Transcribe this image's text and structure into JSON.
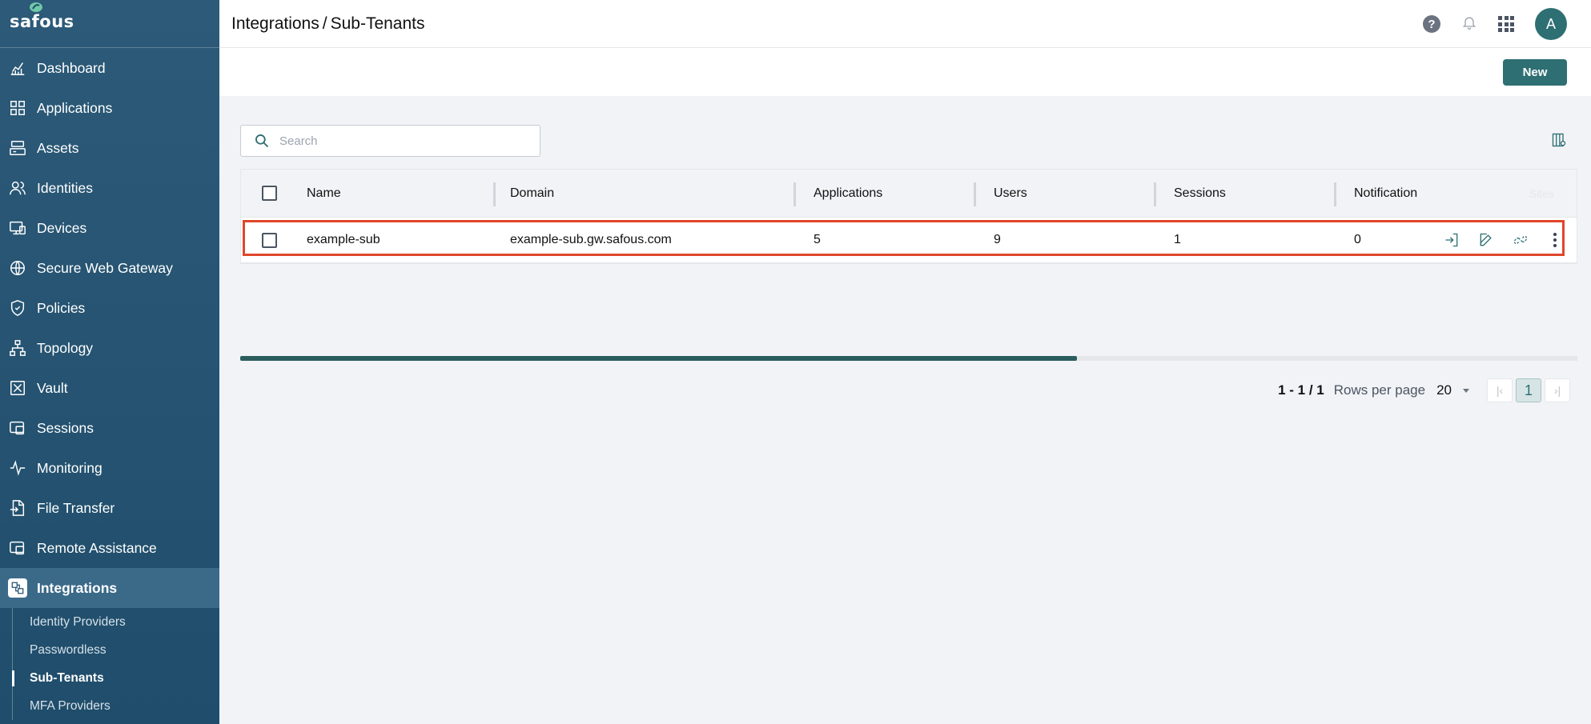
{
  "app": {
    "logo_text": "safous"
  },
  "sidebar": {
    "items": [
      {
        "label": "Dashboard",
        "icon": "chart-line-icon"
      },
      {
        "label": "Applications",
        "icon": "grid-icon"
      },
      {
        "label": "Assets",
        "icon": "server-icon"
      },
      {
        "label": "Identities",
        "icon": "users-icon"
      },
      {
        "label": "Devices",
        "icon": "devices-icon"
      },
      {
        "label": "Secure Web Gateway",
        "icon": "globe-icon"
      },
      {
        "label": "Policies",
        "icon": "shield-icon"
      },
      {
        "label": "Topology",
        "icon": "topology-icon"
      },
      {
        "label": "Vault",
        "icon": "vault-icon"
      },
      {
        "label": "Sessions",
        "icon": "sessions-icon"
      },
      {
        "label": "Monitoring",
        "icon": "pulse-icon"
      },
      {
        "label": "File Transfer",
        "icon": "file-transfer-icon"
      },
      {
        "label": "Remote Assistance",
        "icon": "remote-icon"
      },
      {
        "label": "Integrations",
        "icon": "integrations-icon",
        "active": true
      }
    ],
    "subitems": [
      {
        "label": "Identity Providers"
      },
      {
        "label": "Passwordless"
      },
      {
        "label": "Sub-Tenants",
        "active": true
      },
      {
        "label": "MFA Providers"
      }
    ]
  },
  "header": {
    "breadcrumb_parent": "Integrations",
    "breadcrumb_sep": "/",
    "breadcrumb_current": "Sub-Tenants",
    "avatar_initial": "A"
  },
  "toolbar": {
    "new_label": "New"
  },
  "search": {
    "placeholder": "Search",
    "value": ""
  },
  "table": {
    "columns": [
      "Name",
      "Domain",
      "Applications",
      "Users",
      "Sessions",
      "Notification",
      "Sites"
    ],
    "rows": [
      {
        "name": "example-sub",
        "domain": "example-sub.gw.safous.com",
        "applications": "5",
        "users": "9",
        "sessions": "1",
        "notification": "0"
      }
    ]
  },
  "pagination": {
    "range": "1 - 1 / 1",
    "rows_per_page_label": "Rows per page",
    "rows_per_page": "20",
    "current_page": "1",
    "first_symbol": "|‹",
    "last_symbol": "›|"
  },
  "colors": {
    "accent": "#2e6f73",
    "sidebar": "#1f4d6b",
    "highlight": "#e0472b"
  }
}
